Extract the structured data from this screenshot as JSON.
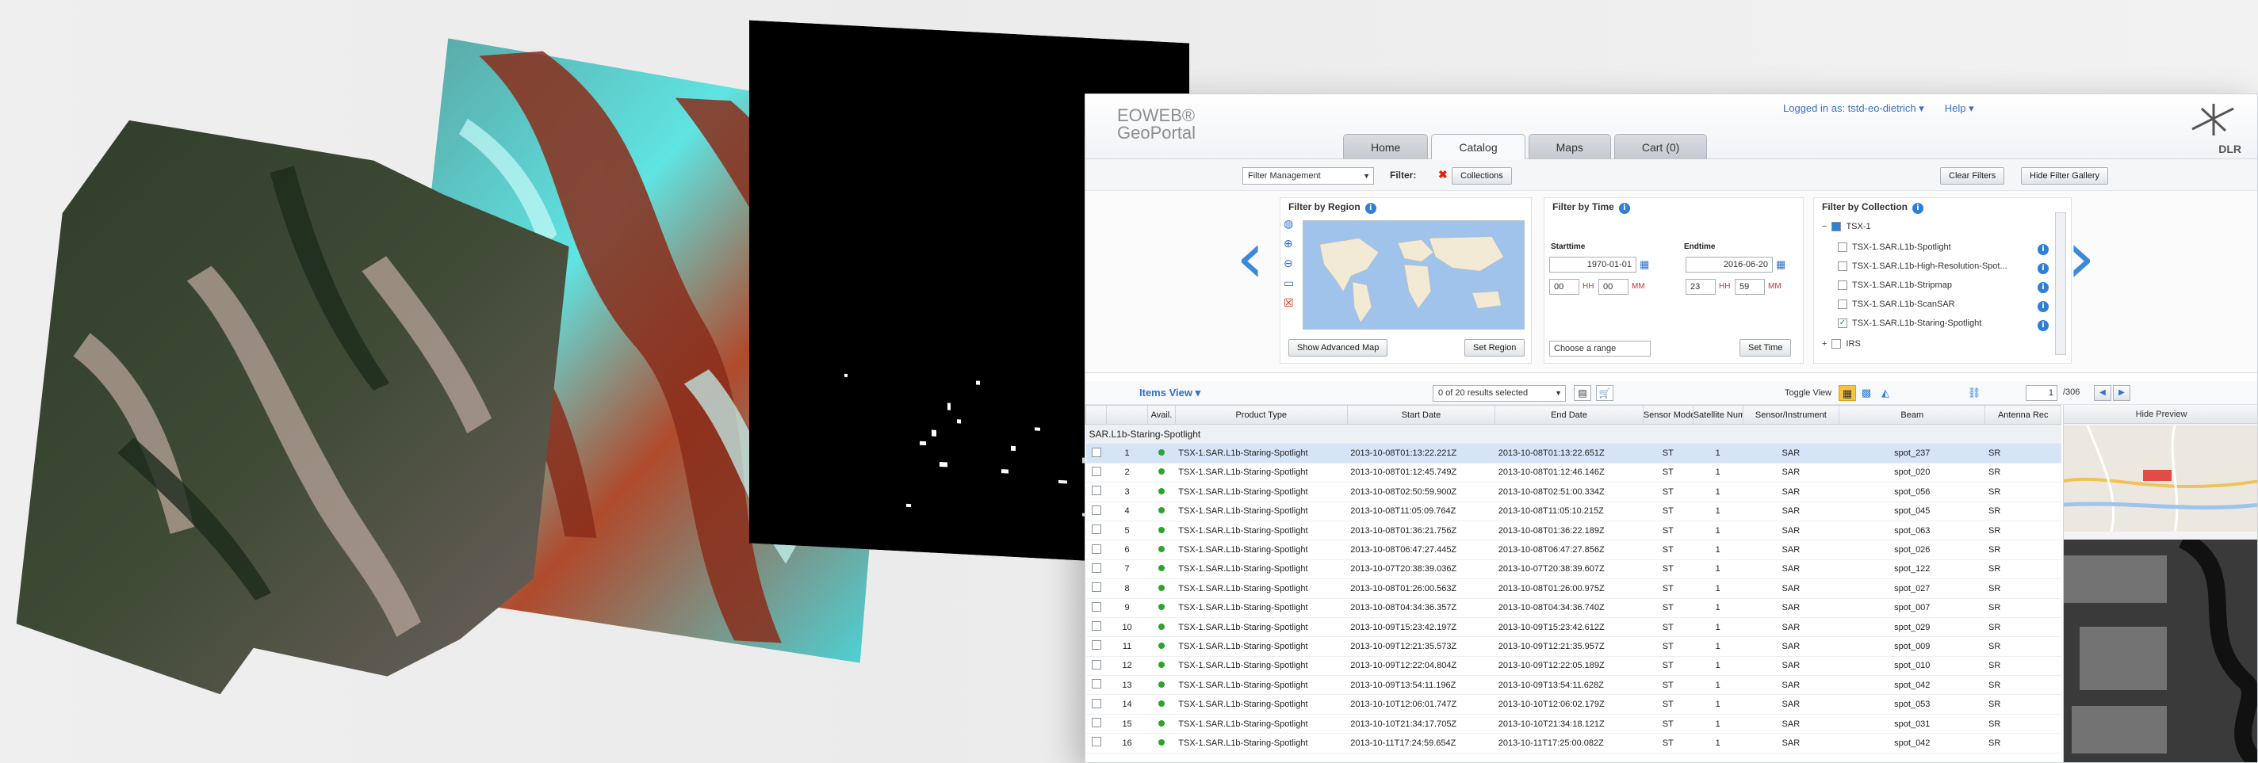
{
  "app": {
    "logo_line1": "EOWEB®",
    "logo_line2": "GeoPortal",
    "tabs": [
      {
        "label": "Home"
      },
      {
        "label": "Catalog"
      },
      {
        "label": "Maps"
      },
      {
        "label": "Cart (0)"
      }
    ],
    "user": "Logged in as: tstd-eo-dietrich ▾",
    "help": "Help ▾",
    "brand": "DLR"
  },
  "filterbar": {
    "select": "Filter Management",
    "filter_label": "Filter:",
    "collections": "Collections",
    "clear": "Clear Filters",
    "hide_gallery": "Hide Filter Gallery"
  },
  "region": {
    "title": "Filter by Region",
    "show_map": "Show Advanced Map",
    "set_region": "Set Region"
  },
  "time": {
    "title": "Filter by Time",
    "start_label": "Starttime",
    "end_label": "Endtime",
    "start_date": "1970-01-01",
    "end_date": "2016-06-20",
    "start_hh": "00",
    "start_mm": "00",
    "end_hh": "23",
    "end_mm": "59",
    "hh": "HH",
    "mm": "MM",
    "range": "Choose a range",
    "set_time": "Set Time"
  },
  "collection": {
    "title": "Filter by Collection",
    "parent": "TSX-1",
    "items": [
      {
        "label": "TSX-1.SAR.L1b-Spotlight",
        "checked": false
      },
      {
        "label": "TSX-1.SAR.L1b-High-Resolution-Spot...",
        "checked": false
      },
      {
        "label": "TSX-1.SAR.L1b-Stripmap",
        "checked": false
      },
      {
        "label": "TSX-1.SAR.L1b-ScanSAR",
        "checked": false
      },
      {
        "label": "TSX-1.SAR.L1b-Staring-Spotlight",
        "checked": true
      }
    ],
    "next": "IRS"
  },
  "toolbar": {
    "items_view": "Items View ▾",
    "results": "0 of 20 results selected",
    "toggle": "Toggle View",
    "page": "1",
    "total": "/306"
  },
  "table": {
    "headers": [
      "",
      "",
      "Avail.",
      "Product Type",
      "Start Date",
      "End Date",
      "Sensor Mode",
      "Satellite Number",
      "Sensor/Instrument",
      "Beam",
      "Antenna Rec"
    ],
    "group": "SAR.L1b-Staring-Spotlight",
    "rows": [
      {
        "n": "1",
        "type": "TSX-1.SAR.L1b-Staring-Spotlight",
        "start": "2013-10-08T01:13:22.221Z",
        "end": "2013-10-08T01:13:22.651Z",
        "mode": "ST",
        "sat": "1",
        "inst": "SAR",
        "beam": "spot_237",
        "ant": "SR"
      },
      {
        "n": "2",
        "type": "TSX-1.SAR.L1b-Staring-Spotlight",
        "start": "2013-10-08T01:12:45.749Z",
        "end": "2013-10-08T01:12:46.146Z",
        "mode": "ST",
        "sat": "1",
        "inst": "SAR",
        "beam": "spot_020",
        "ant": "SR"
      },
      {
        "n": "3",
        "type": "TSX-1.SAR.L1b-Staring-Spotlight",
        "start": "2013-10-08T02:50:59.900Z",
        "end": "2013-10-08T02:51:00.334Z",
        "mode": "ST",
        "sat": "1",
        "inst": "SAR",
        "beam": "spot_056",
        "ant": "SR"
      },
      {
        "n": "4",
        "type": "TSX-1.SAR.L1b-Staring-Spotlight",
        "start": "2013-10-08T11:05:09.764Z",
        "end": "2013-10-08T11:05:10.215Z",
        "mode": "ST",
        "sat": "1",
        "inst": "SAR",
        "beam": "spot_045",
        "ant": "SR"
      },
      {
        "n": "5",
        "type": "TSX-1.SAR.L1b-Staring-Spotlight",
        "start": "2013-10-08T01:36:21.756Z",
        "end": "2013-10-08T01:36:22.189Z",
        "mode": "ST",
        "sat": "1",
        "inst": "SAR",
        "beam": "spot_063",
        "ant": "SR"
      },
      {
        "n": "6",
        "type": "TSX-1.SAR.L1b-Staring-Spotlight",
        "start": "2013-10-08T06:47:27.445Z",
        "end": "2013-10-08T06:47:27.856Z",
        "mode": "ST",
        "sat": "1",
        "inst": "SAR",
        "beam": "spot_026",
        "ant": "SR"
      },
      {
        "n": "7",
        "type": "TSX-1.SAR.L1b-Staring-Spotlight",
        "start": "2013-10-07T20:38:39.036Z",
        "end": "2013-10-07T20:38:39.607Z",
        "mode": "ST",
        "sat": "1",
        "inst": "SAR",
        "beam": "spot_122",
        "ant": "SR"
      },
      {
        "n": "8",
        "type": "TSX-1.SAR.L1b-Staring-Spotlight",
        "start": "2013-10-08T01:26:00.563Z",
        "end": "2013-10-08T01:26:00.975Z",
        "mode": "ST",
        "sat": "1",
        "inst": "SAR",
        "beam": "spot_027",
        "ant": "SR"
      },
      {
        "n": "9",
        "type": "TSX-1.SAR.L1b-Staring-Spotlight",
        "start": "2013-10-08T04:34:36.357Z",
        "end": "2013-10-08T04:34:36.740Z",
        "mode": "ST",
        "sat": "1",
        "inst": "SAR",
        "beam": "spot_007",
        "ant": "SR"
      },
      {
        "n": "10",
        "type": "TSX-1.SAR.L1b-Staring-Spotlight",
        "start": "2013-10-09T15:23:42.197Z",
        "end": "2013-10-09T15:23:42.612Z",
        "mode": "ST",
        "sat": "1",
        "inst": "SAR",
        "beam": "spot_029",
        "ant": "SR"
      },
      {
        "n": "11",
        "type": "TSX-1.SAR.L1b-Staring-Spotlight",
        "start": "2013-10-09T12:21:35.573Z",
        "end": "2013-10-09T12:21:35.957Z",
        "mode": "ST",
        "sat": "1",
        "inst": "SAR",
        "beam": "spot_009",
        "ant": "SR"
      },
      {
        "n": "12",
        "type": "TSX-1.SAR.L1b-Staring-Spotlight",
        "start": "2013-10-09T12:22:04.804Z",
        "end": "2013-10-09T12:22:05.189Z",
        "mode": "ST",
        "sat": "1",
        "inst": "SAR",
        "beam": "spot_010",
        "ant": "SR"
      },
      {
        "n": "13",
        "type": "TSX-1.SAR.L1b-Staring-Spotlight",
        "start": "2013-10-09T13:54:11.196Z",
        "end": "2013-10-09T13:54:11.628Z",
        "mode": "ST",
        "sat": "1",
        "inst": "SAR",
        "beam": "spot_042",
        "ant": "SR"
      },
      {
        "n": "14",
        "type": "TSX-1.SAR.L1b-Staring-Spotlight",
        "start": "2013-10-10T12:06:01.747Z",
        "end": "2013-10-10T12:06:02.179Z",
        "mode": "ST",
        "sat": "1",
        "inst": "SAR",
        "beam": "spot_053",
        "ant": "SR"
      },
      {
        "n": "15",
        "type": "TSX-1.SAR.L1b-Staring-Spotlight",
        "start": "2013-10-10T21:34:17.705Z",
        "end": "2013-10-10T21:34:18.121Z",
        "mode": "ST",
        "sat": "1",
        "inst": "SAR",
        "beam": "spot_031",
        "ant": "SR"
      },
      {
        "n": "16",
        "type": "TSX-1.SAR.L1b-Staring-Spotlight",
        "start": "2013-10-11T17:24:59.654Z",
        "end": "2013-10-11T17:25:00.082Z",
        "mode": "ST",
        "sat": "1",
        "inst": "SAR",
        "beam": "spot_042",
        "ant": "SR"
      }
    ]
  },
  "preview": {
    "title": "Hide Preview"
  },
  "colors": {
    "accent": "#2f7fd6",
    "selected_row": "#d6e4f7",
    "available": "#2fa32f",
    "brand_green": "#2a8b2a"
  }
}
